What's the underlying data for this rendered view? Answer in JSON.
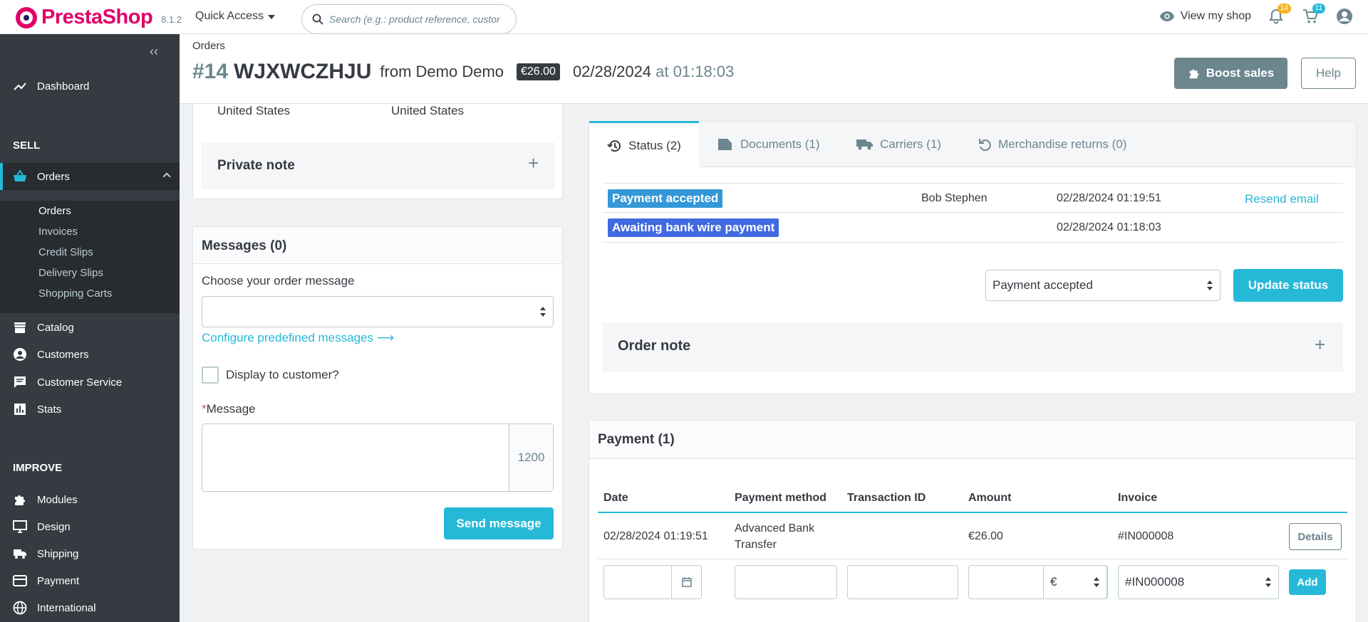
{
  "header": {
    "logo_text": "PrestaShop",
    "version": "8.1.2",
    "quick_access": "Quick Access",
    "search_placeholder": "Search (e.g.: product reference, custon",
    "view_shop": "View my shop",
    "notifications_count": "14",
    "orders_count": "11"
  },
  "sidebar": {
    "dashboard": "Dashboard",
    "sell_section": "SELL",
    "orders": "Orders",
    "sub_items": [
      "Orders",
      "Invoices",
      "Credit Slips",
      "Delivery Slips",
      "Shopping Carts"
    ],
    "catalog": "Catalog",
    "customers": "Customers",
    "customer_service": "Customer Service",
    "stats": "Stats",
    "improve_section": "IMPROVE",
    "modules": "Modules",
    "design": "Design",
    "shipping": "Shipping",
    "payment": "Payment",
    "international": "International"
  },
  "page": {
    "breadcrumb": "Orders",
    "order_number": "#14",
    "order_reference": "WJXWCZHJU",
    "from_customer": "from Demo Demo",
    "total": "€26.00",
    "date": "02/28/2024",
    "at": "at 01:18:03",
    "boost_sales": "Boost sales",
    "help": "Help"
  },
  "address": {
    "country_left": "United States",
    "country_right": "United States",
    "private_note": "Private note"
  },
  "messages": {
    "title": "Messages (0)",
    "choose_label": "Choose your order message",
    "selected": "",
    "configure_link": "Configure predefined messages",
    "display_to_customer": "Display to customer?",
    "required_mark": "*",
    "message_label": "Message",
    "char_counter": "1200",
    "send_button": "Send message"
  },
  "status": {
    "tabs": [
      "Status (2)",
      "Documents (1)",
      "Carriers (1)",
      "Merchandise returns (0)"
    ],
    "history": [
      {
        "status": "Payment accepted",
        "employee": "Bob Stephen",
        "date": "02/28/2024 01:19:51",
        "action": "Resend email",
        "color": "#3498d8"
      },
      {
        "status": "Awaiting bank wire payment",
        "employee": "",
        "date": "02/28/2024 01:18:03",
        "action": "",
        "color": "#4169e1"
      }
    ],
    "select_value": "Payment accepted",
    "update_button": "Update status",
    "order_note": "Order note"
  },
  "payment": {
    "title": "Payment (1)",
    "headers": [
      "Date",
      "Payment method",
      "Transaction ID",
      "Amount",
      "Invoice"
    ],
    "rows": [
      {
        "date": "02/28/2024 01:19:51",
        "method_line1": "Advanced Bank",
        "method_line2": "Transfer",
        "transaction_id": "",
        "amount": "€26.00",
        "invoice": "#IN000008",
        "action": "Details"
      }
    ],
    "form": {
      "currency": "€",
      "invoice": "#IN000008",
      "add_button": "Add"
    }
  },
  "colors": {
    "accent": "#25b9d7",
    "sidebar": "#363a41",
    "brand": "#df0067"
  }
}
